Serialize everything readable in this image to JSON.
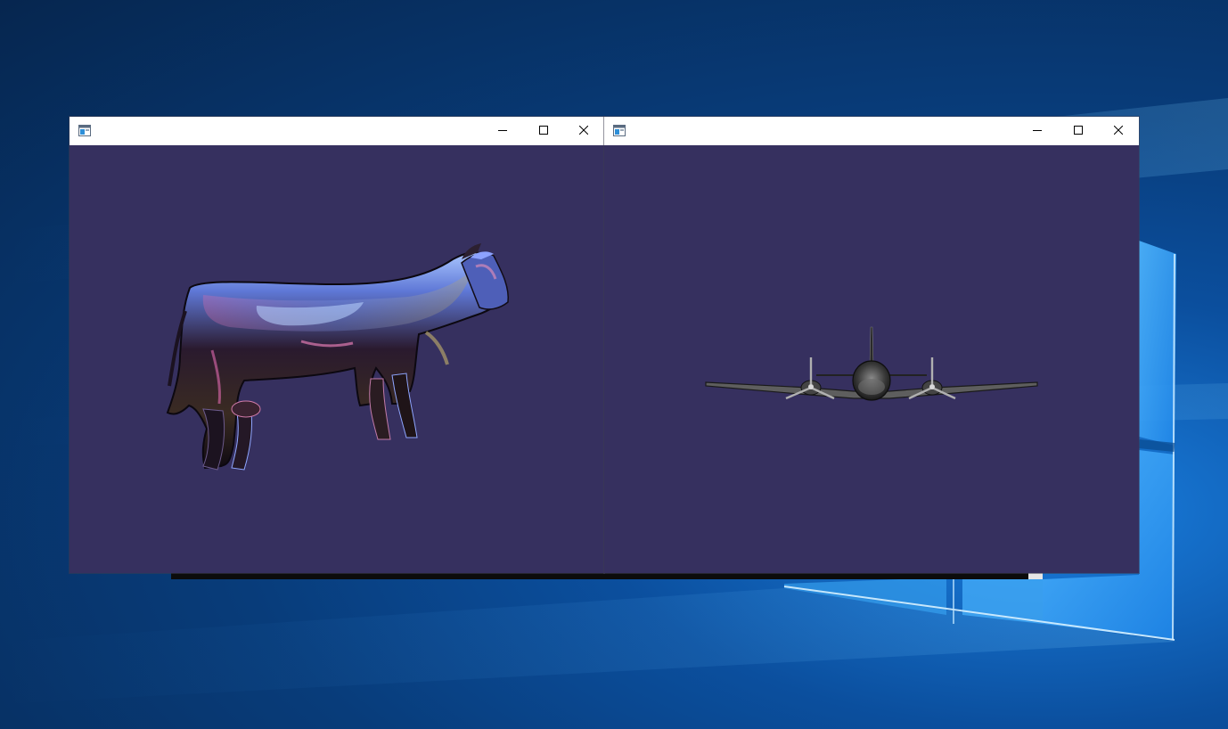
{
  "desktop": {
    "wallpaper": "windows-10-light-beams-wallpaper",
    "accent_colors": [
      "#06264f",
      "#0b4f9e",
      "#1a7fe0",
      "#5fc0ff"
    ]
  },
  "console_window": {
    "partially_visible": true
  },
  "windows": [
    {
      "title": "",
      "icon": "app-window-icon",
      "viewport_background": "#36305f",
      "scene_object": "chrome-reflective-cow-model",
      "controls": [
        "minimize-icon",
        "maximize-icon",
        "close-icon"
      ]
    },
    {
      "title": "",
      "icon": "app-window-icon",
      "viewport_background": "#36305f",
      "scene_object": "twin-propeller-airplane-model",
      "controls": [
        "minimize-icon",
        "maximize-icon",
        "close-icon"
      ]
    }
  ]
}
